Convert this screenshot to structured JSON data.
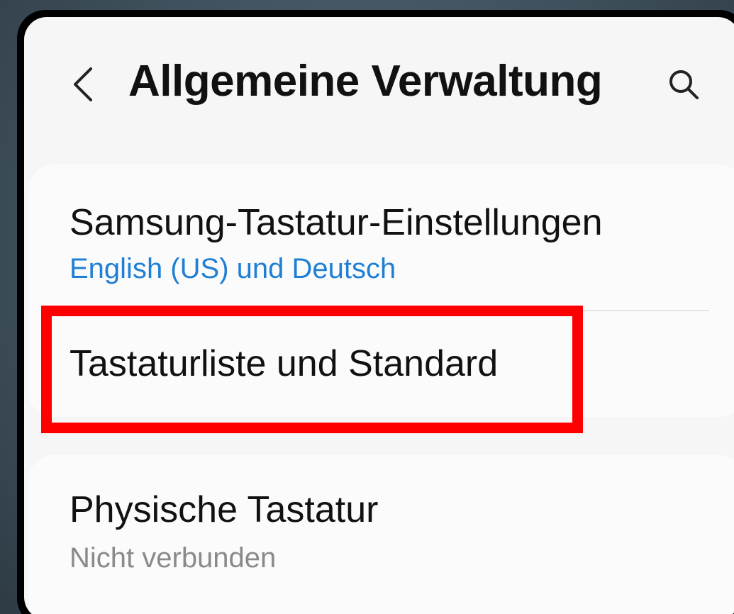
{
  "header": {
    "title": "Allgemeine Verwaltung",
    "back_icon": "chevron-left-icon",
    "search_icon": "search-icon"
  },
  "sections": [
    {
      "items": [
        {
          "title": "Samsung-Tastatur-Einstellungen",
          "subtitle": "English (US) und Deutsch",
          "subtitle_color": "#1f7fd4"
        },
        {
          "title": "Tastaturliste und Standard",
          "highlighted": true
        }
      ]
    },
    {
      "items": [
        {
          "title": "Physische Tastatur",
          "subtitle": "Nicht verbunden",
          "subtitle_color": "#8a8a8a"
        }
      ]
    }
  ],
  "colors": {
    "highlight": "#ff0000",
    "accent": "#1f7fd4",
    "background": "#f6f6f6"
  }
}
